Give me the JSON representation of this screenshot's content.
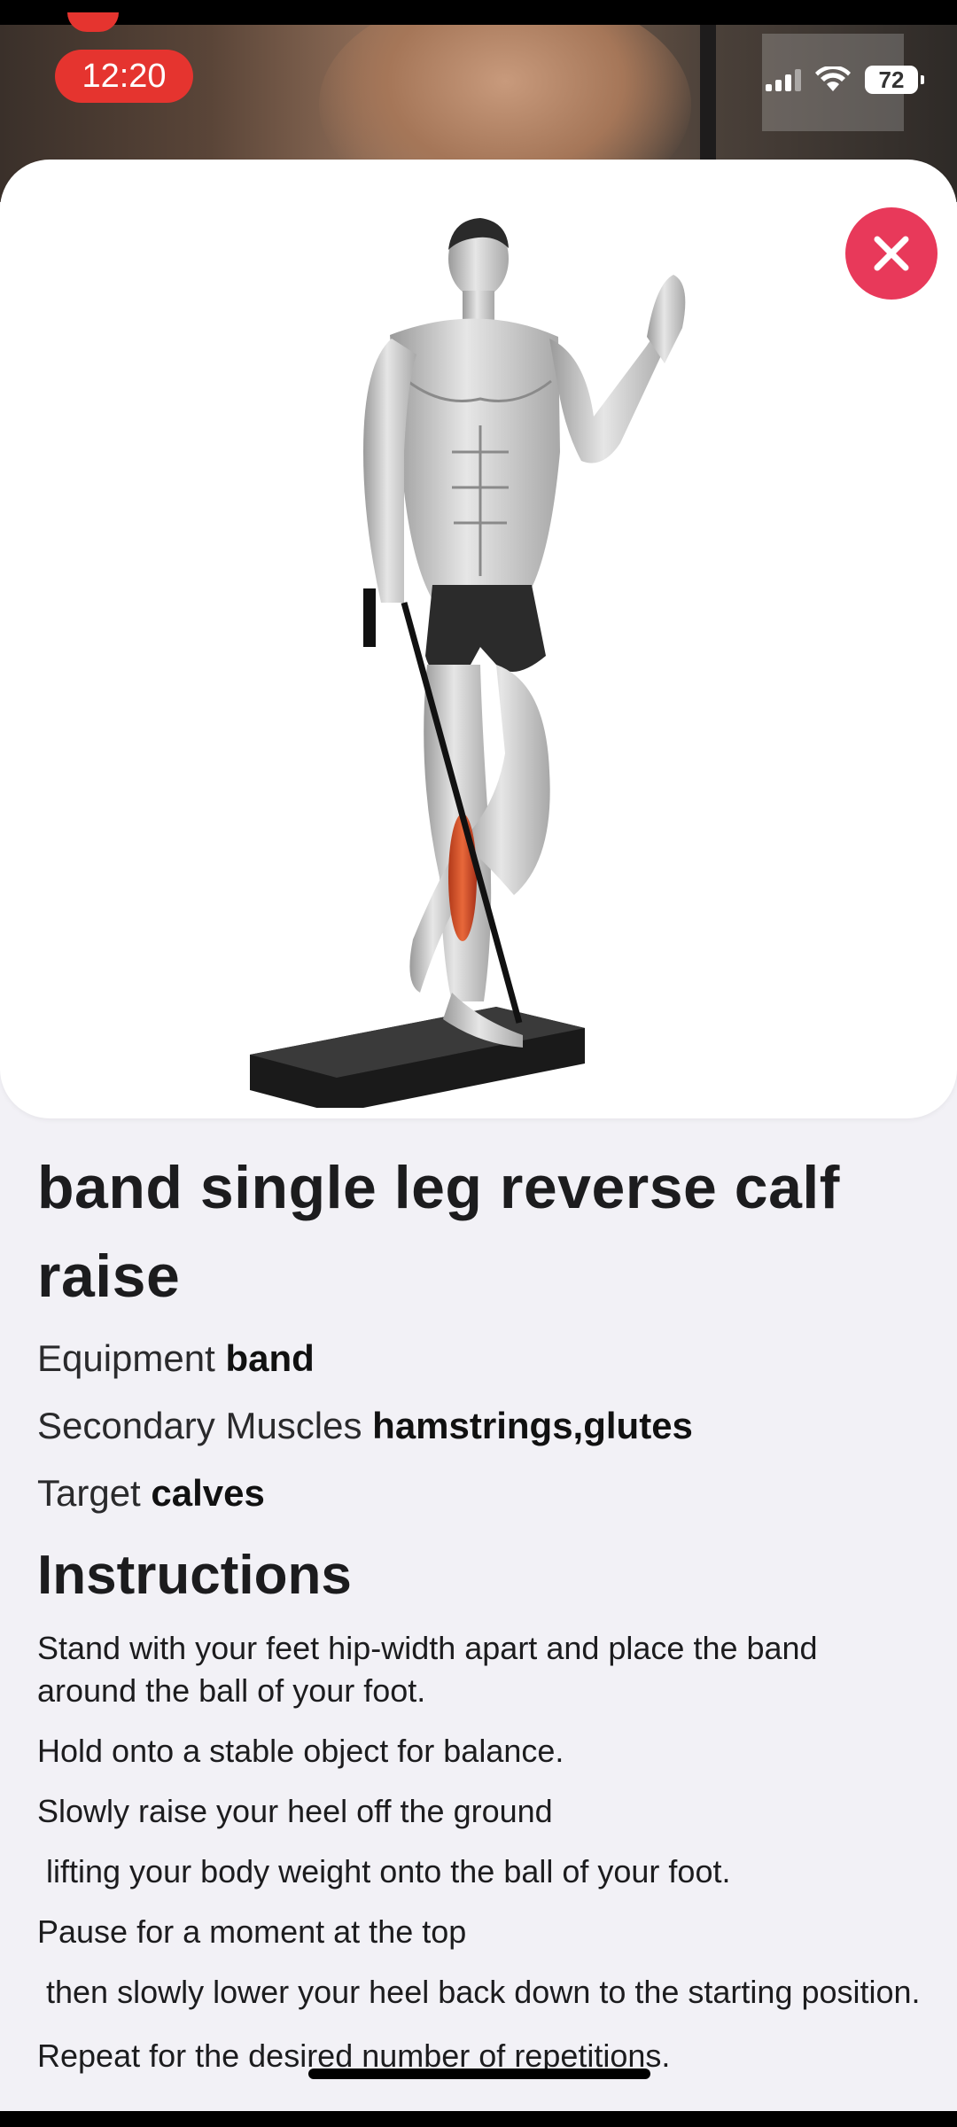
{
  "status_bar": {
    "time": "12:20",
    "battery": "72"
  },
  "sheet": {
    "close_icon": "close-icon",
    "illustration_icon": "band-calf-raise-illustration",
    "accent_color": "#e8395a"
  },
  "exercise": {
    "title": "band single leg reverse calf raise",
    "equipment_label": "Equipment",
    "equipment_value": "band",
    "secondary_label": "Secondary Muscles",
    "secondary_value": "hamstrings,glutes",
    "target_label": "Target",
    "target_value": "calves"
  },
  "instructions": {
    "heading": "Instructions",
    "steps": [
      "Stand with your feet hip-width apart and place the band around the ball of your foot.",
      "Hold onto a stable object for balance.",
      "Slowly raise your heel off the ground",
      " lifting your body weight onto the ball of your foot.",
      "Pause for a moment at the top",
      " then slowly lower your heel back down to the starting position.",
      "Repeat for the desired number of repetitions."
    ]
  }
}
